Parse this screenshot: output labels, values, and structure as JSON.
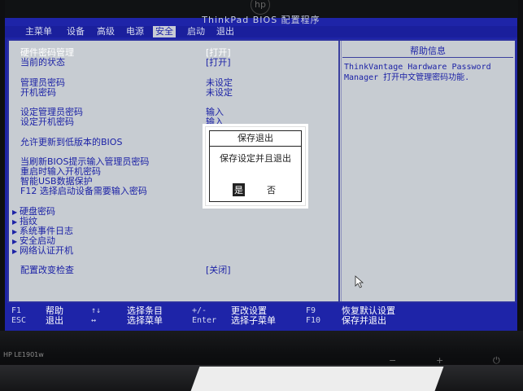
{
  "monitor": {
    "brand_logo": "hp",
    "model": "HP LE1901w",
    "controls": [
      "−",
      "+",
      "⏻"
    ]
  },
  "bios": {
    "title": "ThinkPad BIOS 配置程序",
    "menu": [
      {
        "label": "主菜单"
      },
      {
        "label": "设备"
      },
      {
        "label": "高级"
      },
      {
        "label": "电源"
      },
      {
        "label": "安全"
      },
      {
        "label": "启动"
      },
      {
        "label": "退出"
      }
    ],
    "active_menu": "安全",
    "settings": [
      {
        "label": "硬件密码管理",
        "value": "[打开]"
      },
      {
        "label": "当前的状态",
        "value": "[打开]"
      },
      {
        "label": "管理员密码",
        "value": "未设定"
      },
      {
        "label": "开机密码",
        "value": "未设定"
      },
      {
        "label": "设定管理员密码",
        "value": "输入"
      },
      {
        "label": "设定开机密码",
        "value": "输入"
      },
      {
        "label": "允许更新到低版本的BIOS",
        "value": ""
      },
      {
        "label": "当刷新BIOS提示输入管理员密码",
        "value": ""
      },
      {
        "label": "重启时输入开机密码",
        "value": ""
      },
      {
        "label": "智能USB数据保护",
        "value": ""
      },
      {
        "label": "F12 选择启动设备需要输入密码",
        "value": ""
      }
    ],
    "submenus": [
      {
        "label": "硬盘密码"
      },
      {
        "label": "指纹"
      },
      {
        "label": "系统事件日志"
      },
      {
        "label": "安全启动"
      },
      {
        "label": "网络认证开机"
      }
    ],
    "config_check": {
      "label": "配置改变检查",
      "value": "[关闭]"
    },
    "help": {
      "title": "帮助信息",
      "text": "ThinkVantage Hardware Password Manager 打开中文管理密码功能."
    },
    "dialog": {
      "title": "保存退出",
      "message": "保存设定并且退出",
      "yes": "是",
      "no": "否"
    },
    "footer": [
      {
        "key": "F1",
        "desc": "帮助"
      },
      {
        "key": "ESC",
        "desc": "退出"
      },
      {
        "key": "↑↓",
        "desc": "选择条目"
      },
      {
        "key": "↔",
        "desc": "选择菜单"
      },
      {
        "key": "+/-",
        "desc": "更改设置"
      },
      {
        "key": "Enter",
        "desc": "选择子菜单"
      },
      {
        "key": "F9",
        "desc": "恢复默认设置"
      },
      {
        "key": "F10",
        "desc": "保存并退出"
      }
    ]
  }
}
